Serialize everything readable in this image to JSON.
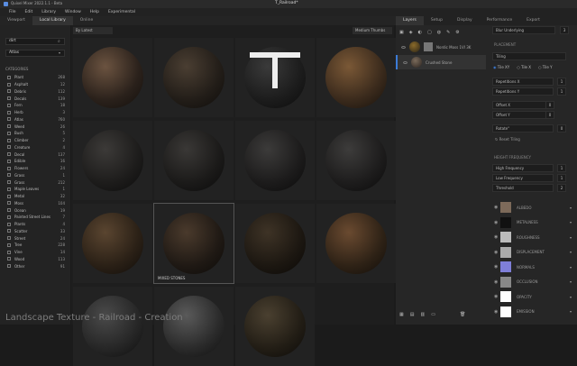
{
  "app_title": "Quixel Mixer 2022.1.1 - Beta",
  "doc_title": "T_Railroad*",
  "menu": [
    "File",
    "Edit",
    "Library",
    "Window",
    "Help",
    "Experimental"
  ],
  "left_tabs": [
    "Viewport",
    "Local Library",
    "Online"
  ],
  "search_value": "dirt",
  "atlas_select": "Atlas",
  "categories_label": "CATEGORIES",
  "categories": [
    {
      "name": "Plant",
      "count": "268"
    },
    {
      "name": "Asphalt",
      "count": "12"
    },
    {
      "name": "Debris",
      "count": "112"
    },
    {
      "name": "Decals",
      "count": "139"
    },
    {
      "name": "Fern",
      "count": "18"
    },
    {
      "name": "Herb",
      "count": "3"
    },
    {
      "name": "Atlas",
      "count": "760"
    },
    {
      "name": "Weed",
      "count": "26"
    },
    {
      "name": "Bush",
      "count": "5"
    },
    {
      "name": "Climber",
      "count": "2"
    },
    {
      "name": "Creature",
      "count": "4"
    },
    {
      "name": "Decal",
      "count": "137"
    },
    {
      "name": "Edible",
      "count": "16"
    },
    {
      "name": "Flowers",
      "count": "24"
    },
    {
      "name": "Grass",
      "count": "1"
    },
    {
      "name": "Grass",
      "count": "212"
    },
    {
      "name": "Maple Leaves",
      "count": "1"
    },
    {
      "name": "Metal",
      "count": "32"
    },
    {
      "name": "Moss",
      "count": "104"
    },
    {
      "name": "Ocean",
      "count": "19"
    },
    {
      "name": "Painted Street Lines",
      "count": "7"
    },
    {
      "name": "Plants",
      "count": "4"
    },
    {
      "name": "Scatter",
      "count": "33"
    },
    {
      "name": "Street",
      "count": "24"
    },
    {
      "name": "Tree",
      "count": "228"
    },
    {
      "name": "Vine",
      "count": "14"
    },
    {
      "name": "Wood",
      "count": "113"
    },
    {
      "name": "Other",
      "count": "91"
    }
  ],
  "sort_select": "By Latest",
  "thumb_select": "Medium Thumbs",
  "tile_label": "MIXED STONES",
  "overlay_title": "Landscape Texture - Railroad - Creation",
  "right_tabs": [
    "Layers",
    "Setup",
    "Display",
    "Performance",
    "Export"
  ],
  "layers": [
    {
      "name": "Nordic Moss 1VI 3K"
    },
    {
      "name": "Crushed Stone"
    }
  ],
  "blend_select": "Blur Underlying",
  "blend_value": "3",
  "placement_label": "PLACEMENT",
  "tiling_select": "Tiling",
  "tile_options": [
    "Tile XY",
    "Tile X",
    "Tile Y"
  ],
  "repetitions_x": {
    "label": "Repetitions X",
    "value": "1"
  },
  "repetitions_y": {
    "label": "Repetitions Y",
    "value": "1"
  },
  "offset_x": {
    "label": "Offset X",
    "value": "0"
  },
  "offset_y": {
    "label": "Offset Y",
    "value": "0"
  },
  "rotate": {
    "label": "Rotate°",
    "value": "0"
  },
  "reset_tiling": "Reset Tiling",
  "height_frequency_label": "HEIGHT FREQUENCY",
  "high_frequency": {
    "label": "High Frequency",
    "value": "1"
  },
  "low_frequency": {
    "label": "Low Frequency",
    "value": "1"
  },
  "threshold": {
    "label": "Threshold",
    "value": "2"
  },
  "channels": [
    "ALBEDO",
    "METALNESS",
    "ROUGHNESS",
    "DISPLACEMENT",
    "NORMALS",
    "OCCLUSION",
    "OPACITY",
    "EMISSION"
  ],
  "colors": {
    "accent": "#3b7bd6"
  }
}
